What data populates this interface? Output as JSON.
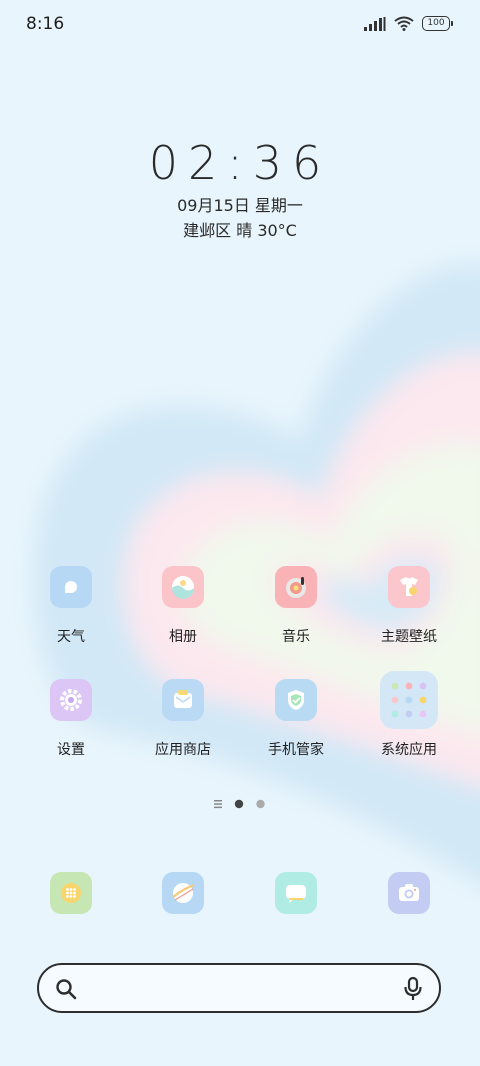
{
  "status_bar": {
    "time": "8:16",
    "battery": "100",
    "icons": [
      "signal-icon",
      "wifi-icon",
      "battery-icon"
    ]
  },
  "lockscreen_clock": {
    "time": "02:36",
    "date": "09月15日 星期一",
    "weather": "建邺区 晴 30°C"
  },
  "apps": [
    {
      "label": "天气",
      "icon": "weather-icon",
      "color": "#b7d8f5"
    },
    {
      "label": "相册",
      "icon": "gallery-icon",
      "color": "#fbc4c9"
    },
    {
      "label": "音乐",
      "icon": "music-icon",
      "color": "#f9b3b6"
    },
    {
      "label": "主题壁纸",
      "icon": "themes-icon",
      "color": "#fbc6cc"
    },
    {
      "label": "设置",
      "icon": "settings-icon",
      "color": "#dcc6f5"
    },
    {
      "label": "应用商店",
      "icon": "app-store-icon",
      "color": "#b9d9f5"
    },
    {
      "label": "手机管家",
      "icon": "security-icon",
      "color": "#b8daf3"
    },
    {
      "label": "系统应用",
      "icon": "folder-icon",
      "color": "#d3e7f7"
    }
  ],
  "dock": [
    {
      "icon": "phone-dialer-icon",
      "color": "#c6e6b4"
    },
    {
      "icon": "browser-icon",
      "color": "#b7d8f5"
    },
    {
      "icon": "messages-icon",
      "color": "#b0ece3"
    },
    {
      "icon": "camera-icon",
      "color": "#c3cdf3"
    }
  ],
  "page_indicator": {
    "pages": 2,
    "current": 1
  },
  "search": {
    "icons": [
      "search-icon",
      "microphone-icon"
    ]
  },
  "colors": {
    "background": "#e8f5fc",
    "heart_outer": "#d2e8f6",
    "heart_pink": "#fce8ef",
    "heart_cream": "#f1f8ec"
  }
}
